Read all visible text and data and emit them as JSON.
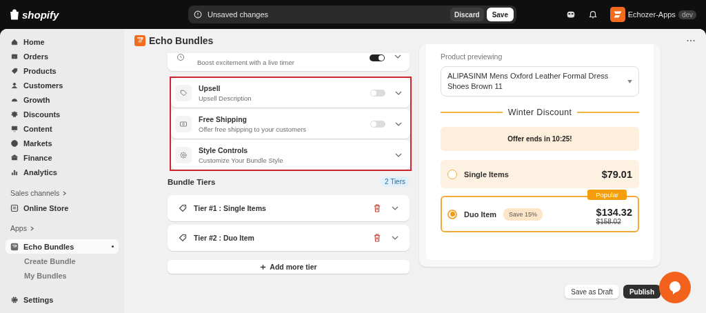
{
  "topbar": {
    "brand": "shopify",
    "notice": "Unsaved changes",
    "discard": "Discard",
    "save": "Save",
    "store": "Echozer-Apps",
    "store_badge": "dev"
  },
  "sidebar": {
    "items": [
      {
        "label": "Home",
        "selected": false
      },
      {
        "label": "Orders",
        "selected": false
      },
      {
        "label": "Products",
        "selected": false
      },
      {
        "label": "Customers",
        "selected": false
      },
      {
        "label": "Growth",
        "selected": false
      },
      {
        "label": "Discounts",
        "selected": false
      },
      {
        "label": "Content",
        "selected": false
      },
      {
        "label": "Markets",
        "selected": false
      },
      {
        "label": "Finance",
        "selected": false
      },
      {
        "label": "Analytics",
        "selected": false
      }
    ],
    "channels_heading": "Sales channels",
    "channels": [
      {
        "label": "Online Store",
        "selected": false
      }
    ],
    "apps_heading": "Apps",
    "apps": [
      {
        "label": "Echo Bundles",
        "selected": true,
        "children": [
          {
            "label": "Create Bundle"
          },
          {
            "label": "My Bundles"
          }
        ]
      }
    ],
    "settings": "Settings"
  },
  "page": {
    "title": "Echo Bundles"
  },
  "features": [
    {
      "kind": "toggle",
      "description": "Boost excitement with a live timer",
      "on": true
    }
  ],
  "highlighted_features": [
    {
      "kind": "toggle",
      "title": "Upsell",
      "description": "Upsell Description",
      "on": false
    },
    {
      "kind": "toggle",
      "title": "Free Shipping",
      "description": "Offer free shipping to your customers",
      "on": false
    },
    {
      "kind": "plain",
      "title": "Style Controls",
      "description": "Customize Your Bundle Style"
    }
  ],
  "tiers": {
    "title": "Bundle Tiers",
    "count": "2 Tiers",
    "items": [
      {
        "label": "Tier #1 : Single Items"
      },
      {
        "label": "Tier #2 : Duo Item"
      }
    ],
    "add": "Add more tier"
  },
  "preview": {
    "label": "Product previewing",
    "product": "ALIPASINM Mens Oxford Leather Formal Dress Shoes Brown 11",
    "heading": "Winter Discount",
    "timer": "Offer ends in 10:25!",
    "options": [
      {
        "name": "Single Items",
        "price": "$79.01",
        "selected": false
      },
      {
        "name": "Duo Item",
        "badge": "Save 15%",
        "tag": "Popular",
        "price": "$134.32",
        "old_price": "$158.02",
        "selected": true
      }
    ]
  },
  "actions": {
    "draft": "Save as Draft",
    "publish": "Publish"
  }
}
